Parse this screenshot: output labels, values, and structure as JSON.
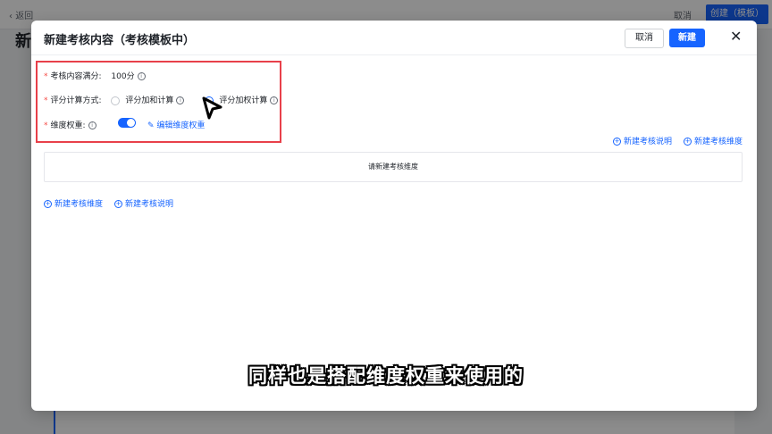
{
  "background": {
    "back_label": "返回",
    "cancel_label": "取消",
    "create_label": "创建（模板）",
    "page_title_fragment": "新"
  },
  "modal": {
    "title": "新建考核内容（考核模板中）",
    "cancel_label": "取消",
    "new_label": "新建"
  },
  "form": {
    "full_score_label": "考核内容满分:",
    "full_score_value": "100分",
    "calc_method_label": "评分计算方式:",
    "calc_options": [
      "评分加和计算",
      "评分加权计算"
    ],
    "dimension_weight_label": "维度权重:",
    "edit_weight_label": "编辑维度权重"
  },
  "actions_top": {
    "new_note": "新建考核说明",
    "new_dimension": "新建考核维度"
  },
  "empty_text": "请新建考核维度",
  "actions_bottom": {
    "new_dimension": "新建考核维度",
    "new_note": "新建考核说明"
  },
  "subtitle": "同样也是搭配维度权重来使用的",
  "colors": {
    "primary": "#1664ff",
    "highlight_border": "#e8404a",
    "required": "#f54a45"
  }
}
